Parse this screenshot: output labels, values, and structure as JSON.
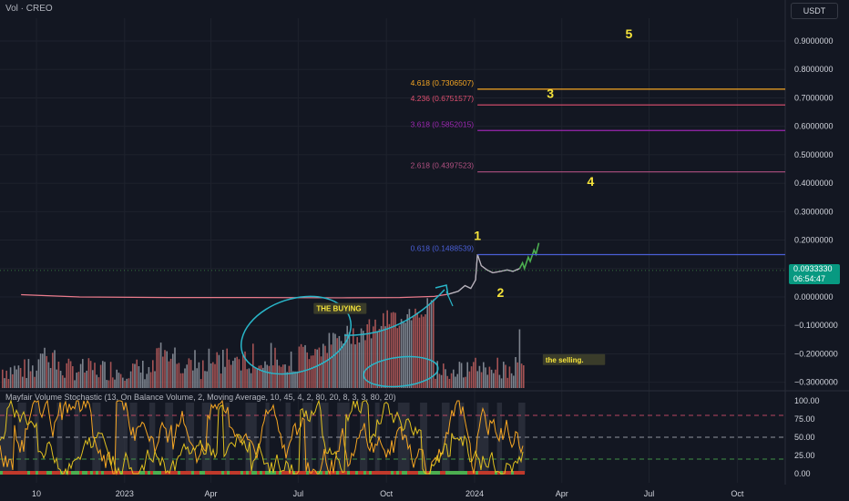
{
  "header": {
    "symbol_label": "Vol · CREO",
    "currency": "USDT"
  },
  "indicator": {
    "label": "Mayfair Volume Stochastic (13, On Balance Volume, 2, Moving Average, 10, 45, 4, 2, 80, 20, 8, 3, 3, 80, 20)"
  },
  "last_price": {
    "value": "0.0933330",
    "countdown": "06:54:47"
  },
  "colors": {
    "background": "#131722",
    "grid": "#1e222d",
    "axis_text": "#d1d4dc",
    "price_line": "#ea7b8c",
    "price_line_2024": "#b2b5be",
    "projection": "#4caf50",
    "annotation": "#29b6c9",
    "wave_label": "#f5e33b",
    "fib_4618": "#f5a623",
    "fib_4236": "#e05070",
    "fib_3618": "#9c27b0",
    "fib_2618": "#b05080",
    "fib_0618": "#4a5fd6",
    "volume_up": "#b55a5a",
    "volume_down": "#8a8f9a",
    "stoch_fast": "#f6a623",
    "stoch_slow": "#e0c020"
  },
  "chart_data": [
    {
      "type": "line",
      "title": "Vol · CREO",
      "y_axis": {
        "ticks": [
          "0.9000000",
          "0.8000000",
          "0.7000000",
          "0.6000000",
          "0.5000000",
          "0.4000000",
          "0.3000000",
          "0.2000000",
          "0.1000000",
          "0.0000000",
          "−0.1000000",
          "−0.2000000",
          "−0.3000000"
        ],
        "ylim": [
          -0.33,
          1.0
        ]
      },
      "x_axis": {
        "ticks": [
          "10",
          "2023",
          "Apr",
          "Jul",
          "Oct",
          "2024",
          "Apr",
          "Jul",
          "Oct"
        ]
      },
      "price_series": {
        "name": "CREO",
        "points": [
          {
            "x": "2022-09",
            "y": 0.008
          },
          {
            "x": "2022-11",
            "y": 0.0
          },
          {
            "x": "2023-02",
            "y": -0.002
          },
          {
            "x": "2023-05",
            "y": -0.002
          },
          {
            "x": "2023-08",
            "y": -0.003
          },
          {
            "x": "2023-10",
            "y": -0.002
          },
          {
            "x": "2023-11-20",
            "y": 0.002
          },
          {
            "x": "2023-12-05",
            "y": 0.01
          },
          {
            "x": "2023-12-15",
            "y": 0.02
          },
          {
            "x": "2023-12-22",
            "y": 0.04
          },
          {
            "x": "2023-12-28",
            "y": 0.03
          },
          {
            "x": "2024-01-02",
            "y": 0.06
          },
          {
            "x": "2024-01-04",
            "y": 0.15
          },
          {
            "x": "2024-01-08",
            "y": 0.11
          },
          {
            "x": "2024-01-14",
            "y": 0.095
          },
          {
            "x": "2024-01-20",
            "y": 0.085
          },
          {
            "x": "2024-01-28",
            "y": 0.09
          },
          {
            "x": "2024-02-04",
            "y": 0.095
          },
          {
            "x": "2024-02-10",
            "y": 0.09
          },
          {
            "x": "2024-02-17",
            "y": 0.1
          }
        ]
      },
      "projection_series": {
        "points": [
          {
            "x": "2024-02-17",
            "y": 0.1
          },
          {
            "x": "2024-02-20",
            "y": 0.12
          },
          {
            "x": "2024-02-22",
            "y": 0.1
          },
          {
            "x": "2024-02-26",
            "y": 0.14
          },
          {
            "x": "2024-02-28",
            "y": 0.125
          },
          {
            "x": "2024-03-03",
            "y": 0.165
          },
          {
            "x": "2024-03-05",
            "y": 0.15
          },
          {
            "x": "2024-03-08",
            "y": 0.19
          }
        ]
      },
      "fib_levels": [
        {
          "label": "4.618 (0.7306507)",
          "value": 0.7306507,
          "color_key": "fib_4618",
          "x_start": "2024-01-04"
        },
        {
          "label": "4.236 (0.6751577)",
          "value": 0.6751577,
          "color_key": "fib_4236",
          "x_start": "2024-01-04"
        },
        {
          "label": "3.618 (0.5852015)",
          "value": 0.5852015,
          "color_key": "fib_3618",
          "x_start": "2024-01-04"
        },
        {
          "label": "2.618 (0.4397523)",
          "value": 0.4397523,
          "color_key": "fib_2618",
          "x_start": "2024-01-04"
        },
        {
          "label": "0.618 (0.1488539)",
          "value": 0.1488539,
          "color_key": "fib_0618",
          "x_start": "2024-01-04"
        }
      ],
      "wave_labels": [
        {
          "text": "1",
          "x": "2024-01-04",
          "y": 0.2
        },
        {
          "text": "2",
          "x": "2024-01-28",
          "y": 0.0
        },
        {
          "text": "3",
          "x": "2024-03-20",
          "y": 0.7
        },
        {
          "text": "4",
          "x": "2024-05-01",
          "y": 0.39
        },
        {
          "text": "5",
          "x": "2024-06-10",
          "y": 0.91
        }
      ],
      "annotations": [
        {
          "text": "THE BUYING",
          "x": "2023-07-20",
          "y": -0.05
        },
        {
          "text": "the selling.",
          "x": "2024-03-15",
          "y": -0.23
        }
      ],
      "volume": {
        "note": "volume histogram overlaid on lower price pane",
        "region_buying": {
          "from": "2023-07",
          "to": "2023-11"
        },
        "region_selling": {
          "from": "2024-01",
          "to": "2024-02"
        }
      }
    },
    {
      "type": "line",
      "title": "Mayfair Volume Stochastic (13, On Balance Volume, 2, Moving Average, 10, 45, 4, 2, 80, 20, 8, 3, 3, 80, 20)",
      "y_axis": {
        "ticks": [
          "100.00",
          "75.00",
          "50.00",
          "25.00",
          "0.00"
        ],
        "ylim": [
          0,
          100
        ]
      },
      "levels": [
        {
          "value": 80,
          "style": "dashed",
          "color_key": "fib_4236"
        },
        {
          "value": 50,
          "style": "dashed",
          "color_key": "price_line_2024"
        },
        {
          "value": 20,
          "style": "dashed",
          "color_key": "projection"
        }
      ]
    }
  ]
}
